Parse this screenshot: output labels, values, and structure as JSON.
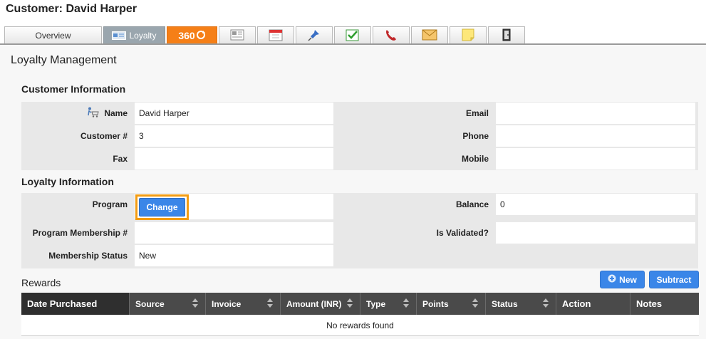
{
  "header": {
    "title": "Customer: David Harper"
  },
  "tabs": {
    "overview": "Overview",
    "loyalty": "Loyalty",
    "t360": "360",
    "icons": [
      "newspaper-icon",
      "calendar-icon",
      "pin-icon",
      "task-check-icon",
      "phone-icon",
      "envelope-icon",
      "note-icon",
      "door-icon"
    ]
  },
  "page": {
    "title": "Loyalty Management"
  },
  "customer_info": {
    "title": "Customer Information",
    "name_label": "Name",
    "name_value": "David Harper",
    "email_label": "Email",
    "email_value": "",
    "customer_no_label": "Customer #",
    "customer_no_value": "3",
    "phone_label": "Phone",
    "phone_value": "",
    "fax_label": "Fax",
    "fax_value": "",
    "mobile_label": "Mobile",
    "mobile_value": ""
  },
  "loyalty_info": {
    "title": "Loyalty Information",
    "program_label": "Program",
    "change_label": "Change",
    "balance_label": "Balance",
    "balance_value": "0",
    "membership_no_label": "Program Membership #",
    "membership_no_value": "",
    "validated_label": "Is Validated?",
    "validated_value": "",
    "status_label": "Membership Status",
    "status_value": "New"
  },
  "rewards": {
    "title": "Rewards",
    "new_label": "New",
    "subtract_label": "Subtract",
    "columns": [
      "Date Purchased",
      "Source",
      "Invoice",
      "Amount (INR)",
      "Type",
      "Points",
      "Status",
      "Action",
      "Notes"
    ],
    "empty_text": "No rewards found"
  },
  "colors": {
    "accent": "#3a86e8",
    "highlight": "#f39c12",
    "tab_360": "#f57f17"
  }
}
